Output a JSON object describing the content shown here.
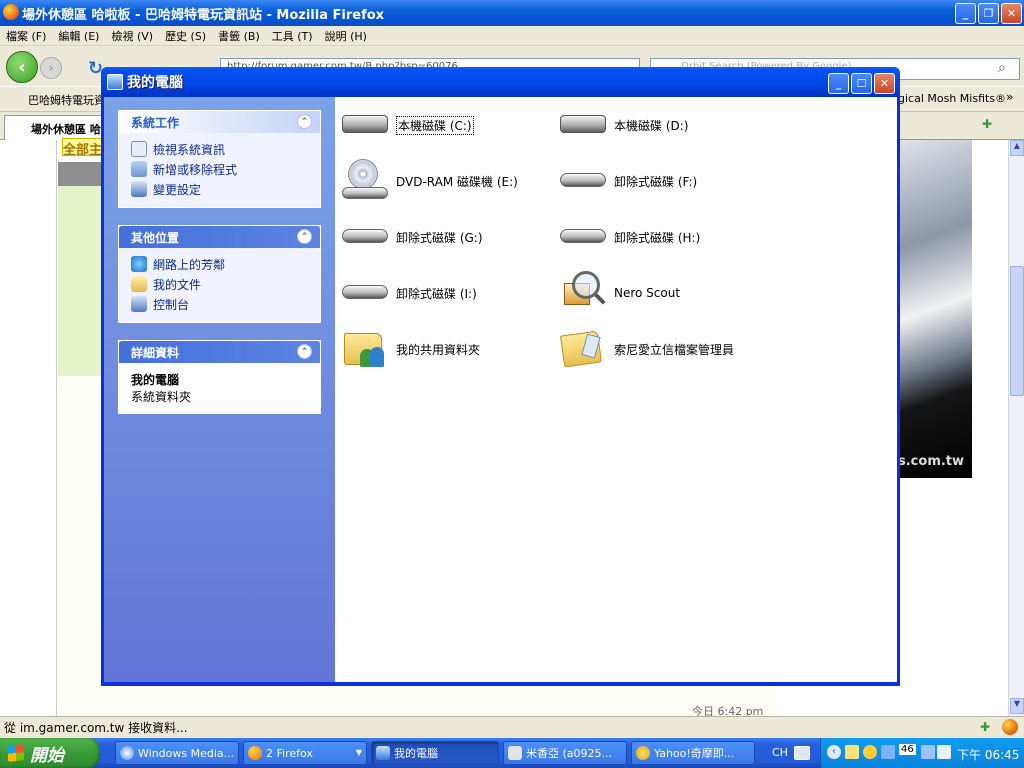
{
  "firefox": {
    "title": "場外休憩區 哈啦板 - 巴哈姆特電玩資訊站 - Mozilla Firefox",
    "menu": [
      "檔案 (F)",
      "編輯 (E)",
      "檢視 (V)",
      "歷史 (S)",
      "書籤 (B)",
      "工具 (T)",
      "說明 (H)"
    ],
    "url": "http://forum.gamer.com.tw/B.php?bsn=60076",
    "search_placeholder": "Orbit Search (Powered By Google)",
    "bookmark_left": "巴哈姆特電玩資",
    "bookmark_right": "gical Mosh Misfits®",
    "tab_label": "場外休憩區 哈",
    "status": "從 im.gamer.com.tw 接收資料...",
    "page_bits": {
      "all_btn": "全部主",
      "ad_text": "s.com.tw",
      "row_time": "今日 6:42 pm"
    }
  },
  "my_computer": {
    "title": "我的電腦",
    "tasks": {
      "header": "系統工作",
      "items": [
        "檢視系統資訊",
        "新增或移除程式",
        "變更設定"
      ]
    },
    "other": {
      "header": "其他位置",
      "items": [
        "網路上的芳鄰",
        "我的文件",
        "控制台"
      ]
    },
    "details": {
      "header": "詳細資料",
      "name": "我的電腦",
      "desc": "系統資料夾"
    },
    "items": [
      {
        "label": "本機磁碟 (C:)",
        "icon": "hard-drive-icon"
      },
      {
        "label": "本機磁碟 (D:)",
        "icon": "hard-drive-icon"
      },
      {
        "label": "DVD-RAM 磁碟機 (E:)",
        "icon": "dvd-drive-icon"
      },
      {
        "label": "卸除式磁碟 (F:)",
        "icon": "removable-disk-icon"
      },
      {
        "label": "卸除式磁碟 (G:)",
        "icon": "removable-disk-icon"
      },
      {
        "label": "卸除式磁碟 (H:)",
        "icon": "removable-disk-icon"
      },
      {
        "label": "卸除式磁碟 (I:)",
        "icon": "removable-disk-icon"
      },
      {
        "label": "Nero Scout",
        "icon": "nero-scout-icon"
      },
      {
        "label": "我的共用資料夾",
        "icon": "shared-folder-icon"
      },
      {
        "label": "索尼愛立信檔案管理員",
        "icon": "file-manager-folder-icon"
      }
    ]
  },
  "taskbar": {
    "start": "開始",
    "tasks": [
      "Windows Media...",
      "2 Firefox",
      "我的電腦",
      "米香亞 (a0925...",
      "Yahoo!奇摩即..."
    ],
    "lang": "CH",
    "clock": "下午 06:45",
    "badge": "46"
  }
}
